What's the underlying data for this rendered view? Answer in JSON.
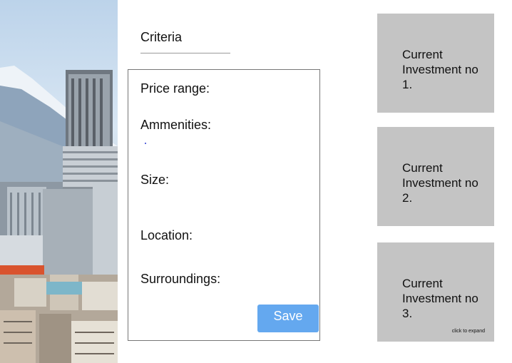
{
  "criteria": {
    "title": "Criteria",
    "fields": [
      {
        "label": "Price range:"
      },
      {
        "label": "Ammenities:"
      },
      {
        "label": "Size:"
      },
      {
        "label": "Location:"
      },
      {
        "label": "Surroundings:"
      }
    ],
    "save_label": "Save"
  },
  "investments": [
    {
      "label": "Current Investment no 1."
    },
    {
      "label": "Current Investment no 2."
    },
    {
      "label": "Current Investment no 3.",
      "hint": "click to expand"
    }
  ],
  "colors": {
    "save_button": "#64a8ef",
    "card_background": "#c4c4c4",
    "form_border": "#777777"
  }
}
